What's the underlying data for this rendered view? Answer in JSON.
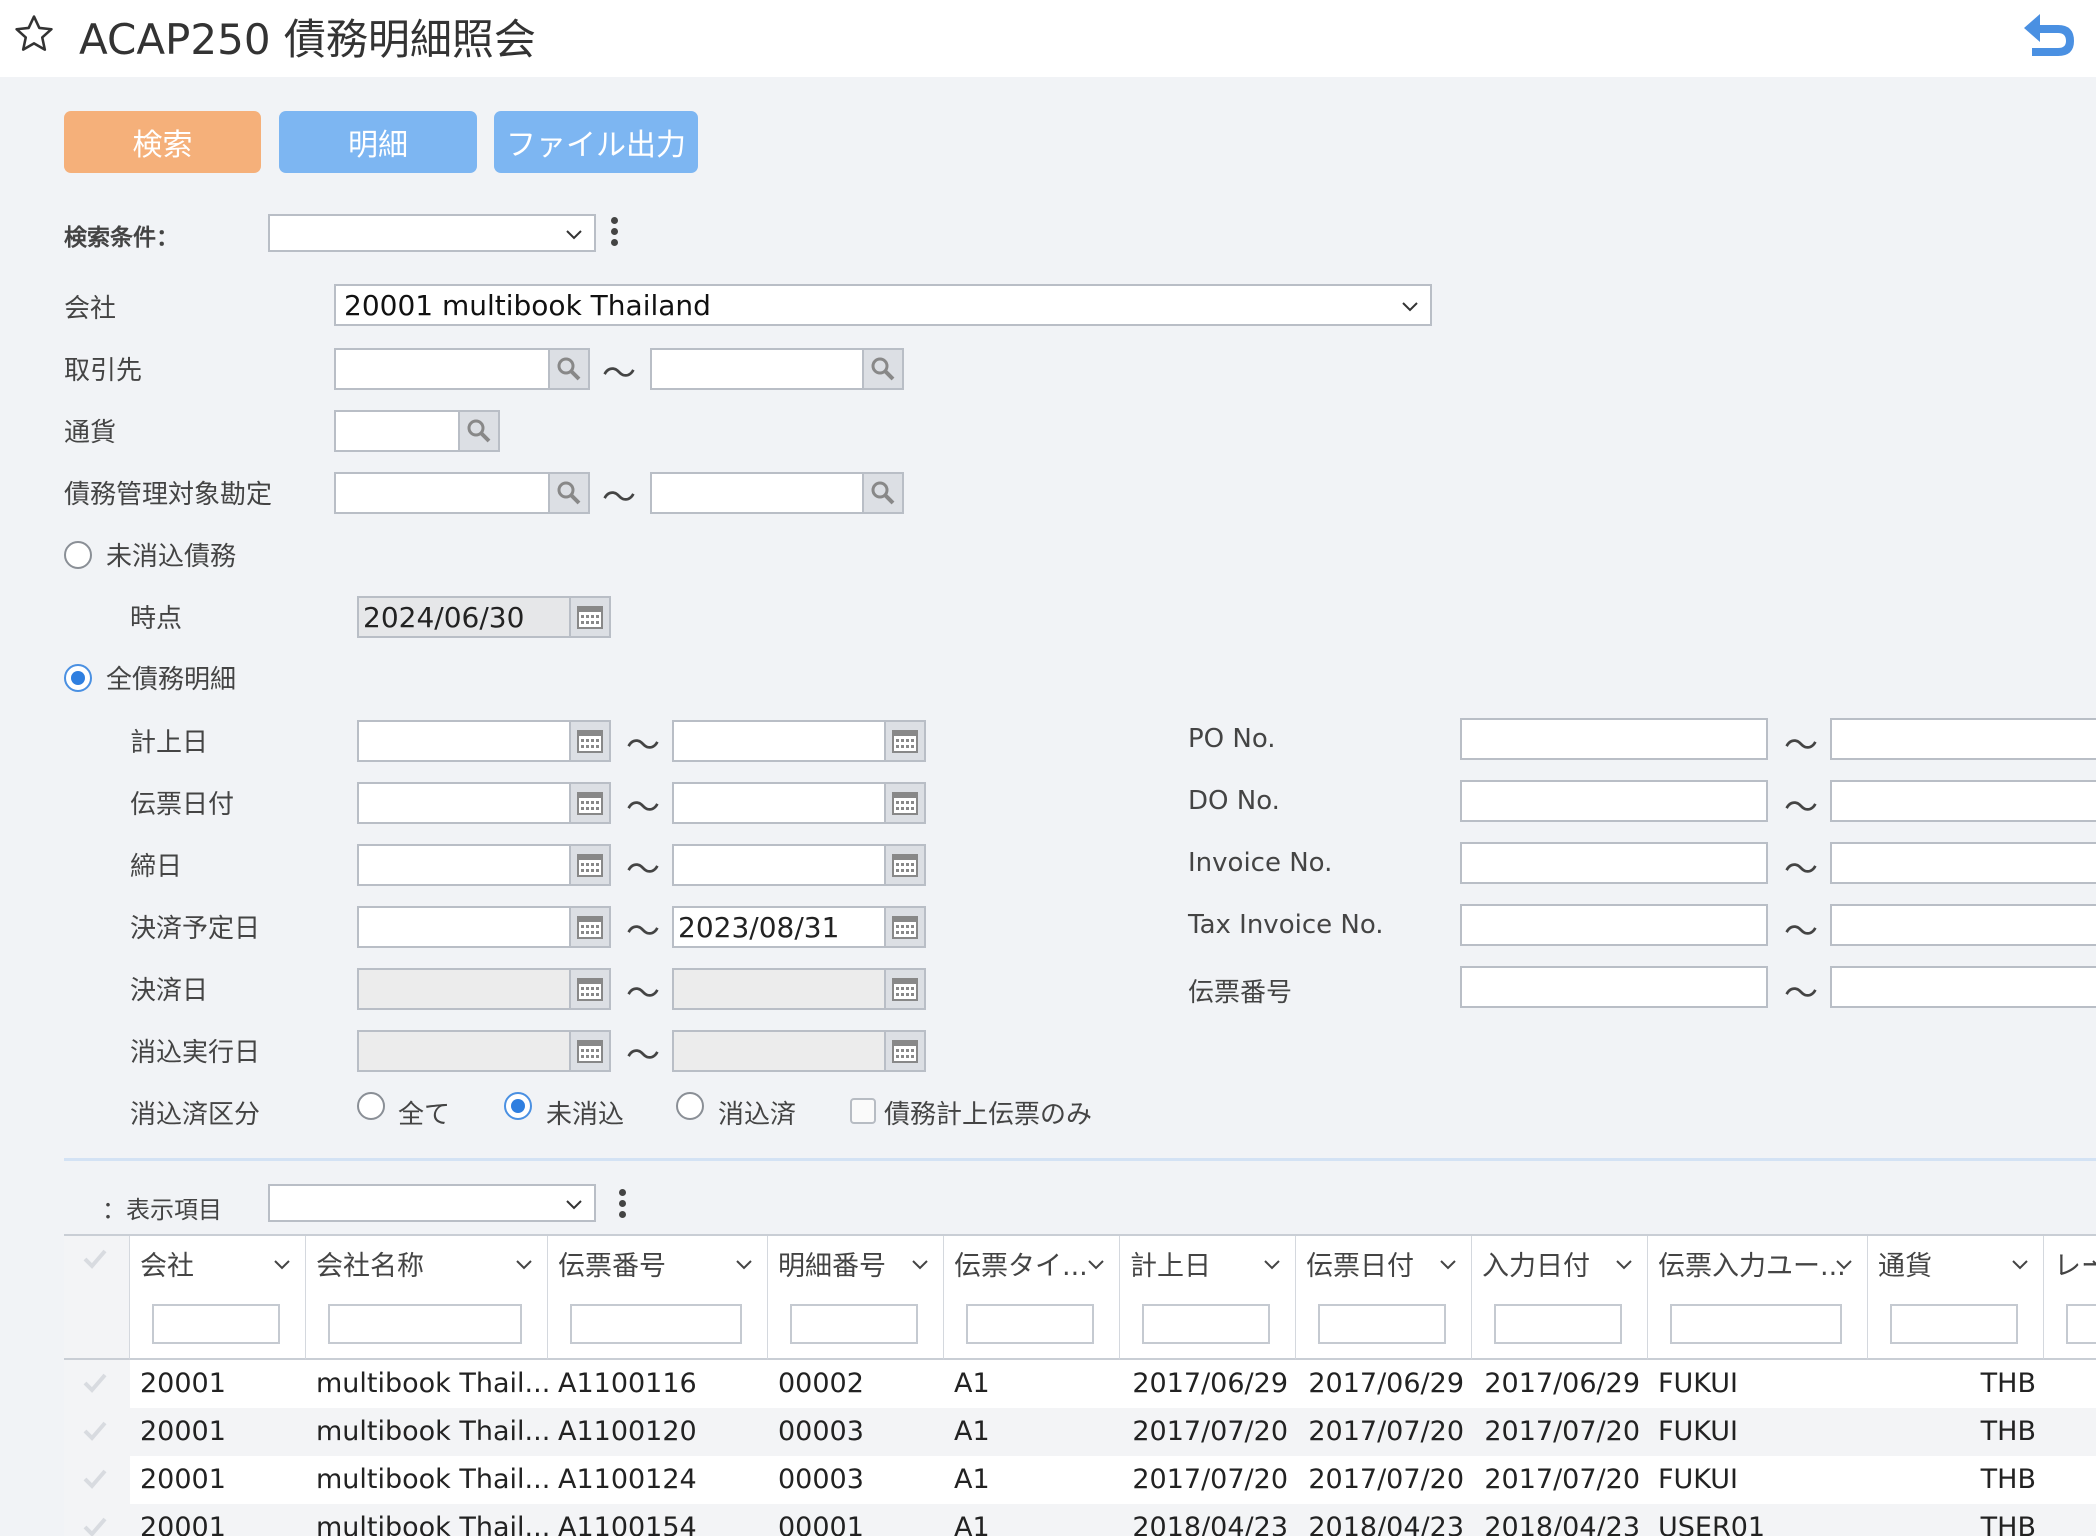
{
  "header": {
    "title": "ACAP250 債務明細照会"
  },
  "toolbar": {
    "search": "検索",
    "detail": "明細",
    "export": "ファイル出力"
  },
  "conditions": {
    "label": "検索条件：",
    "value": ""
  },
  "form": {
    "company_label": "会社",
    "company_value": "20001 multibook Thailand",
    "partner_label": "取引先",
    "currency_label": "通貨",
    "account_label": "債務管理対象勘定",
    "unsettled_label": "未消込債務",
    "point_label": "時点",
    "point_value": "2024/06/30",
    "all_label": "全債務明細",
    "dates": [
      {
        "label": "計上日",
        "from": "",
        "to": ""
      },
      {
        "label": "伝票日付",
        "from": "",
        "to": ""
      },
      {
        "label": "締日",
        "from": "",
        "to": ""
      },
      {
        "label": "決済予定日",
        "from": "",
        "to": "2023/08/31"
      },
      {
        "label": "決済日",
        "from": "",
        "to": ""
      },
      {
        "label": "消込実行日",
        "from": "",
        "to": ""
      }
    ],
    "right_fields": [
      {
        "label": "PO No."
      },
      {
        "label": "DO No."
      },
      {
        "label": "Invoice No."
      },
      {
        "label": "Tax Invoice No."
      },
      {
        "label": "伝票番号"
      }
    ],
    "tilde": "〜",
    "clear_label": "消込済区分",
    "clear_options": [
      "全て",
      "未消込",
      "消込済"
    ],
    "clear_selected": "未消込",
    "only_label": "債務計上伝票のみ"
  },
  "display": {
    "label": "：表示項目",
    "value": ""
  },
  "grid": {
    "columns": [
      "会社",
      "会社名称",
      "伝票番号",
      "明細番号",
      "伝票タイ...",
      "計上日",
      "伝票日付",
      "入力日付",
      "伝票入力ユー...",
      "通貨",
      "レー"
    ],
    "rows": [
      [
        "20001",
        "multibook Thail...",
        "A1100116",
        "00002",
        "A1",
        "2017/06/29",
        "2017/06/29",
        "2017/06/29",
        "FUKUI",
        "THB"
      ],
      [
        "20001",
        "multibook Thail...",
        "A1100120",
        "00003",
        "A1",
        "2017/07/20",
        "2017/07/20",
        "2017/07/20",
        "FUKUI",
        "THB"
      ],
      [
        "20001",
        "multibook Thail...",
        "A1100124",
        "00003",
        "A1",
        "2017/07/20",
        "2017/07/20",
        "2017/07/20",
        "FUKUI",
        "THB"
      ],
      [
        "20001",
        "multibook Thail...",
        "A1100154",
        "00001",
        "A1",
        "2018/04/23",
        "2018/04/23",
        "2018/04/23",
        "USER01",
        "THB"
      ]
    ]
  }
}
